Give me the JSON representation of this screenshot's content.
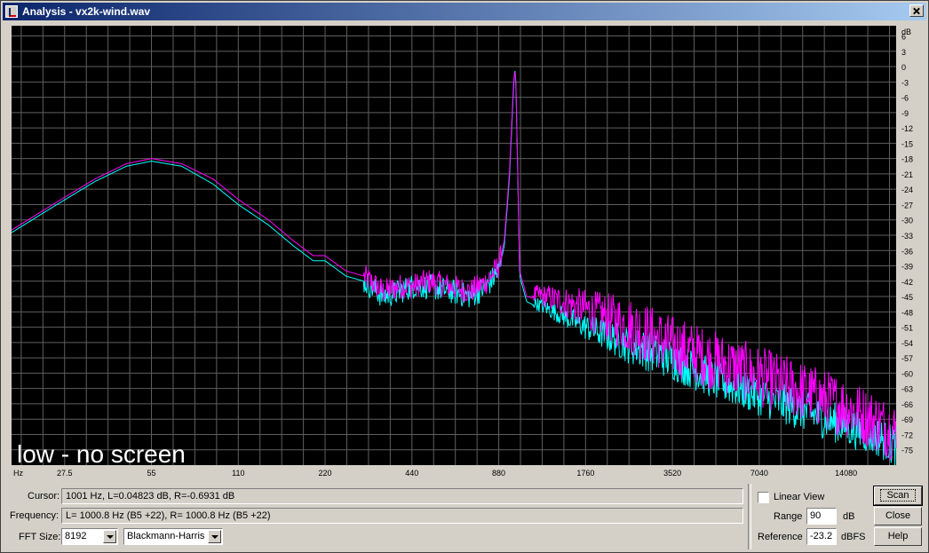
{
  "window": {
    "title": "Analysis - vx2k-wind.wav"
  },
  "plot": {
    "overlay_text": "low - no screen",
    "x_unit": "Hz",
    "y_unit": "dB",
    "x_ticks": [
      "27.5",
      "55",
      "110",
      "220",
      "440",
      "880",
      "1760",
      "3520",
      "7040",
      "14080"
    ],
    "y_ticks": [
      6,
      3,
      0,
      -3,
      -6,
      -9,
      -12,
      -15,
      -18,
      -21,
      -24,
      -27,
      -30,
      -33,
      -36,
      -39,
      -42,
      -45,
      -48,
      -51,
      -54,
      -57,
      -60,
      -63,
      -66,
      -69,
      -72,
      -75
    ],
    "colors": {
      "background": "#000000",
      "grid": "#5f5f5f",
      "left_channel": "#ff00ff",
      "right_channel": "#00ffff"
    }
  },
  "chart_data": {
    "type": "line",
    "x_scale": "log",
    "xlim": [
      18,
      21000
    ],
    "ylim": [
      -78,
      8
    ],
    "xlabel": "Hz",
    "ylabel": "dB",
    "series": [
      {
        "color": "#ff00ff",
        "x": [
          18,
          25,
          35,
          45,
          55,
          70,
          90,
          110,
          140,
          170,
          200,
          220,
          260,
          300,
          350,
          400,
          440,
          500,
          600,
          700,
          800,
          880,
          920,
          960,
          990,
          1001,
          1010,
          1040,
          1100,
          1300,
          1760,
          2500,
          3520,
          5000,
          7040,
          10000,
          14080,
          18000,
          21000
        ],
        "y": [
          -32,
          -27,
          -22,
          -19,
          -18,
          -19,
          -22,
          -26,
          -30,
          -34,
          -37,
          -37,
          -40,
          -41,
          -44,
          -43,
          -43,
          -42,
          -43,
          -44,
          -42,
          -39,
          -34,
          -20,
          -3,
          -0.7,
          -3,
          -40,
          -45,
          -46,
          -49,
          -53,
          -57,
          -60,
          -63,
          -66,
          -69,
          -72,
          -74
        ]
      },
      {
        "color": "#00ffff",
        "x": [
          18,
          25,
          35,
          45,
          55,
          70,
          90,
          110,
          140,
          170,
          200,
          220,
          260,
          300,
          350,
          400,
          440,
          500,
          600,
          700,
          800,
          880,
          920,
          960,
          990,
          1001,
          1010,
          1040,
          1100,
          1300,
          1760,
          2500,
          3520,
          5000,
          7040,
          10000,
          14080,
          18000,
          21000
        ],
        "y": [
          -32.5,
          -27.5,
          -22.5,
          -19.5,
          -18.5,
          -19.5,
          -23,
          -27,
          -31,
          -35,
          -38,
          -38,
          -41,
          -42,
          -45,
          -44,
          -43,
          -43,
          -44,
          -45,
          -43,
          -40,
          -35,
          -21,
          -4,
          -0.05,
          -4,
          -41,
          -46,
          -48,
          -52,
          -56,
          -59,
          -63,
          -66,
          -69,
          -72,
          -74,
          -76
        ]
      }
    ]
  },
  "status": {
    "cursor_label": "Cursor:",
    "cursor_value": "1001 Hz, L=0.04823 dB, R=-0.6931 dB",
    "frequency_label": "Frequency:",
    "frequency_value": "L= 1000.8 Hz (B5 +22), R= 1000.8 Hz (B5 +22)",
    "fft_label": "FFT Size:",
    "fft_value": "8192",
    "window_value": "Blackmann-Harris"
  },
  "options": {
    "linear_view_label": "Linear View",
    "linear_view_checked": false,
    "range_label": "Range",
    "range_value": "90",
    "range_unit": "dB",
    "reference_label": "Reference",
    "reference_value": "-23.2",
    "reference_unit": "dBFS"
  },
  "buttons": {
    "scan": "Scan",
    "close": "Close",
    "help": "Help"
  }
}
